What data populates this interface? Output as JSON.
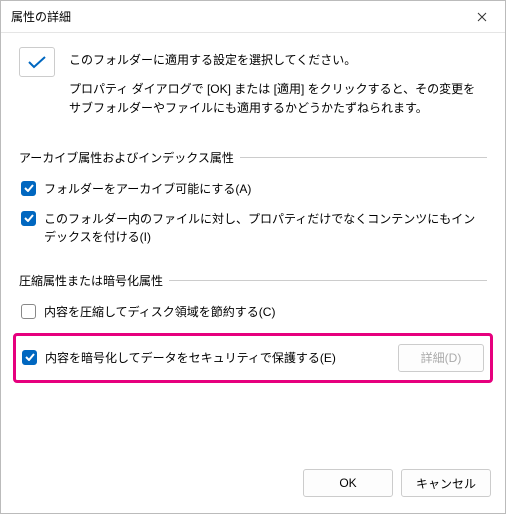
{
  "title": "属性の詳細",
  "intro": {
    "line1": "このフォルダーに適用する設定を選択してください。",
    "line2": "プロパティ ダイアログで [OK] または [適用] をクリックすると、その変更をサブフォルダーやファイルにも適用するかどうかたずねられます。"
  },
  "group1": {
    "title": "アーカイブ属性およびインデックス属性",
    "opt1": {
      "label": "フォルダーをアーカイブ可能にする(A)",
      "checked": true
    },
    "opt2": {
      "label": "このフォルダー内のファイルに対し、プロパティだけでなくコンテンツにもインデックスを付ける(I)",
      "checked": true
    }
  },
  "group2": {
    "title": "圧縮属性または暗号化属性",
    "opt1": {
      "label": "内容を圧縮してディスク領域を節約する(C)",
      "checked": false
    },
    "opt2": {
      "label": "内容を暗号化してデータをセキュリティで保護する(E)",
      "checked": true
    },
    "detail_btn": "詳細(D)"
  },
  "footer": {
    "ok": "OK",
    "cancel": "キャンセル"
  }
}
